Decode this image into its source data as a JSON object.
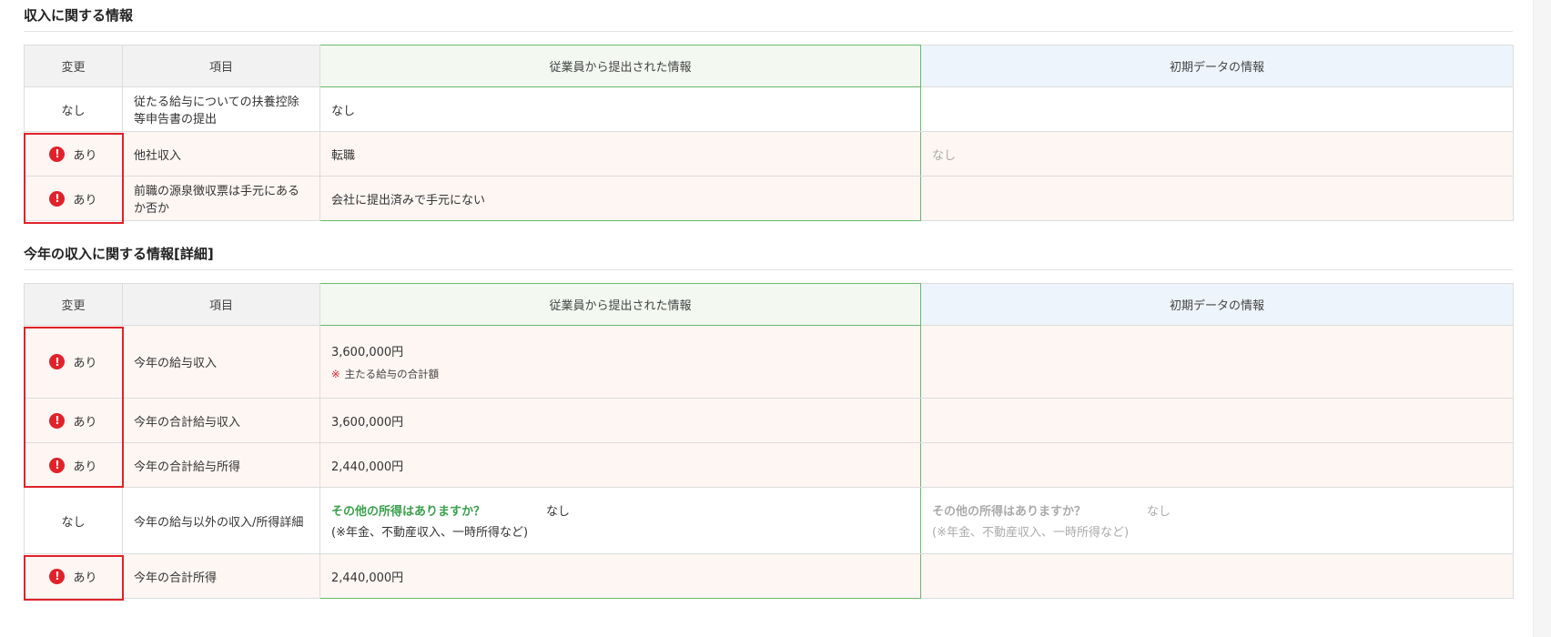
{
  "sections": [
    {
      "title": "収入に関する情報",
      "headers": [
        "変更",
        "項目",
        "従業員から提出された情報",
        "初期データの情報"
      ],
      "rows": [
        {
          "change": "なし",
          "item": "従たる給与についての扶養控除等申告書の提出",
          "employee": "なし",
          "initial": ""
        },
        {
          "change": "あり",
          "item": "他社収入",
          "employee": "転職",
          "initial": "なし"
        },
        {
          "change": "あり",
          "item": "前職の源泉徴収票は手元にあるか否か",
          "employee": "会社に提出済みで手元にない",
          "initial": ""
        }
      ]
    },
    {
      "title": "今年の収入に関する情報[詳細]",
      "headers": [
        "変更",
        "項目",
        "従業員から提出された情報",
        "初期データの情報"
      ],
      "rows": [
        {
          "change": "あり",
          "item": "今年の給与収入",
          "employee": "3,600,000円",
          "employee_note_mark": "※",
          "employee_note": "主たる給与の合計額",
          "initial": ""
        },
        {
          "change": "あり",
          "item": "今年の合計給与収入",
          "employee": "3,600,000円",
          "initial": ""
        },
        {
          "change": "あり",
          "item": "今年の合計給与所得",
          "employee": "2,440,000円",
          "initial": ""
        },
        {
          "change": "なし",
          "item": "今年の給与以外の収入/所得詳細",
          "employee_question": "その他の所得はありますか？",
          "employee_answer": "なし",
          "employee_sub": "(※年金、不動産収入、一時所得など)",
          "initial_question": "その他の所得はありますか？",
          "initial_answer": "なし",
          "initial_sub": "(※年金、不動産収入、一時所得など)"
        },
        {
          "change": "あり",
          "item": "今年の合計所得",
          "employee": "2,440,000円",
          "initial": ""
        }
      ]
    }
  ],
  "colors": {
    "alert": "#e0222a",
    "employee_border": "#66ba6a",
    "employee_question": "#3aa14b",
    "changed_row_bg": "#fdf6f3"
  },
  "icons": {
    "alert": "exclamation-circle-icon"
  },
  "icon_glyph": "!"
}
